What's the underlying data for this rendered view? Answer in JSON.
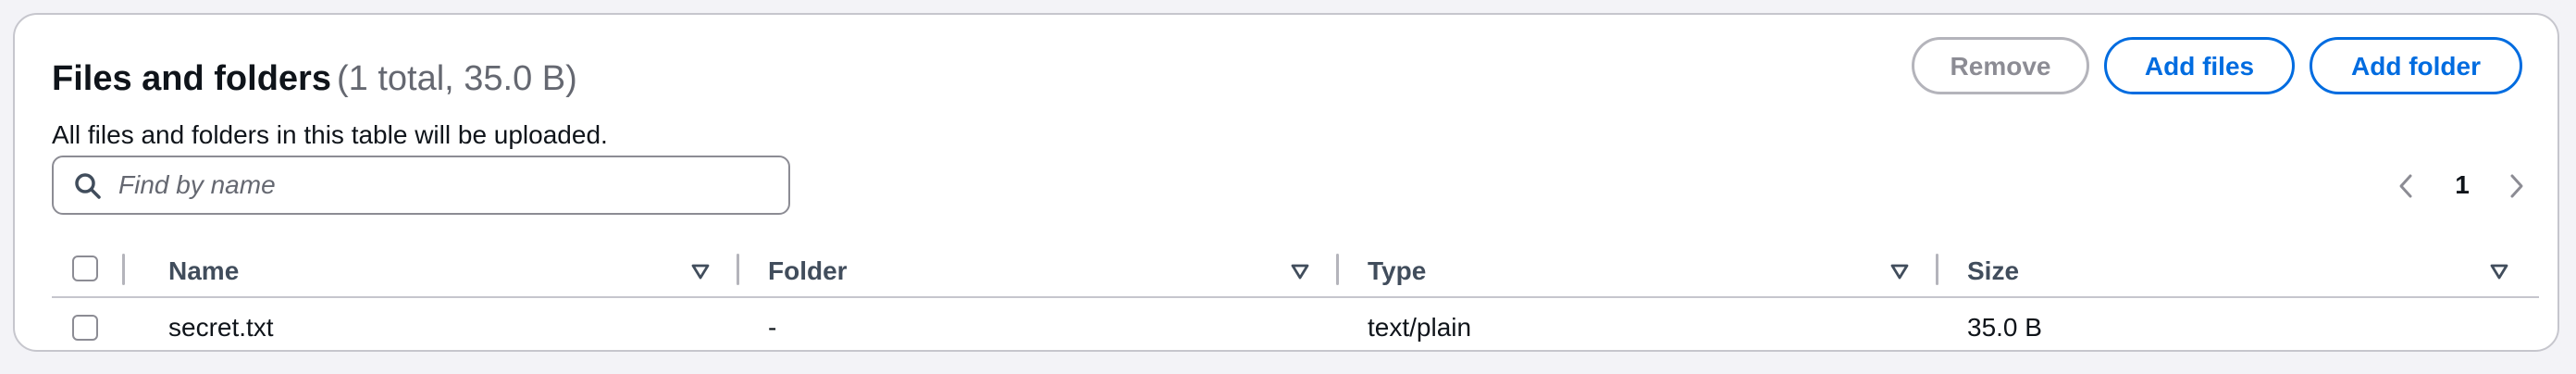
{
  "header": {
    "title": "Files and folders",
    "count": "(1 total, 35.0 B)",
    "description": "All files and folders in this table will be uploaded."
  },
  "actions": {
    "remove_label": "Remove",
    "add_files_label": "Add files",
    "add_folder_label": "Add folder"
  },
  "search": {
    "placeholder": "Find by name",
    "value": ""
  },
  "pagination": {
    "current_page": "1"
  },
  "table": {
    "columns": [
      "Name",
      "Folder",
      "Type",
      "Size"
    ],
    "rows": [
      {
        "name": "secret.txt",
        "folder": "-",
        "type": "text/plain",
        "size": "35.0 B"
      }
    ]
  },
  "colors": {
    "accent": "#006ce0",
    "disabled": "#8c8c94",
    "border": "#c6c6cd",
    "text": "#0f141a"
  }
}
